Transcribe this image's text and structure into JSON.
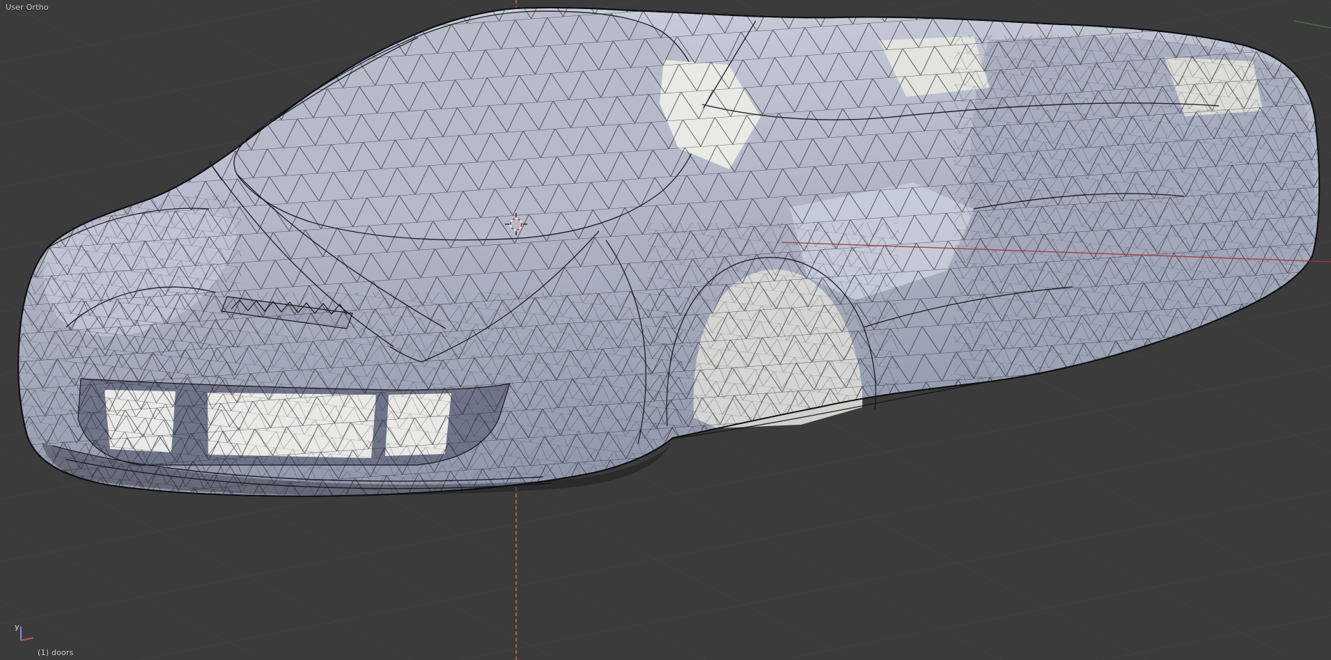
{
  "viewport": {
    "view_label": "User Ortho",
    "status_label": "(1) doors",
    "gizmo": {
      "axis_label": "y"
    }
  },
  "colors": {
    "background": "#3b3b3b",
    "grid_line": "#474747",
    "axis_x_red": "#9e3a36",
    "axis_y_green": "#3f8f3f",
    "cursor_guide_orange": "#c87a3a",
    "wireframe": "#1e2026",
    "body_light": "#cfd2dd",
    "body_mid": "#b4b8c9",
    "body_dark": "#9298ac",
    "opening_white": "#e9e9e6",
    "cursor_red": "#c8443a",
    "cursor_white": "#f2f2f2"
  }
}
